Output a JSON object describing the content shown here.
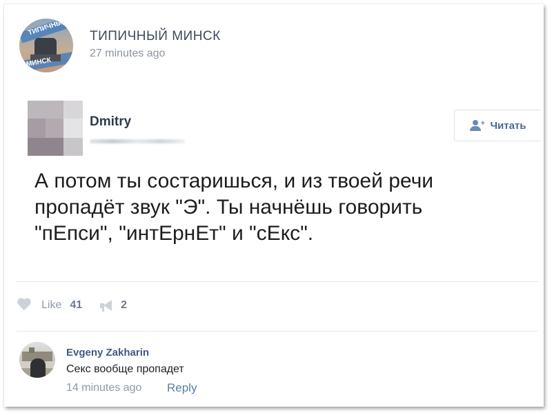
{
  "header": {
    "group_name": "ТИПИЧНЫЙ МИНСК",
    "post_time": "27 minutes ago",
    "avatar_text_top": "ТИПИЧНЫ",
    "avatar_text_bottom": "МИНСК"
  },
  "author": {
    "name": "Dmitry",
    "follow_label": "Читать"
  },
  "post": {
    "lines": [
      "А потом ты состаришься, и из твоей речи",
      "пропадёт звук \"Э\". Ты начнёшь говорить",
      "\"пЕпси\", \"интЕрнЕт\" и \"сЕкс\"."
    ]
  },
  "actions": {
    "like_label": "Like",
    "like_count": "41",
    "share_count": "2"
  },
  "comment": {
    "author": "Evgeny Zakharin",
    "text": "Секс вообще пропадет",
    "time": "14 minutes ago",
    "reply_label": "Reply"
  }
}
